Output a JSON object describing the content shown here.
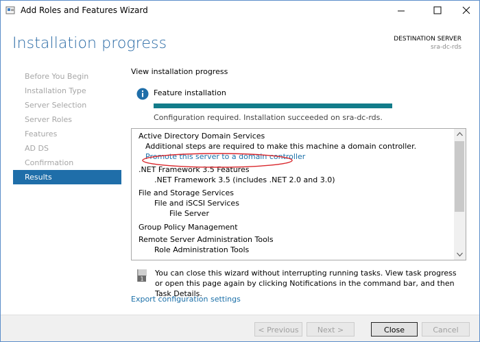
{
  "window": {
    "title": "Add Roles and Features Wizard"
  },
  "header": {
    "page_title": "Installation progress",
    "destination_label": "DESTINATION SERVER",
    "destination_name": "sra-dc-rds"
  },
  "nav": {
    "items": [
      {
        "label": "Before You Begin",
        "active": false
      },
      {
        "label": "Installation Type",
        "active": false
      },
      {
        "label": "Server Selection",
        "active": false
      },
      {
        "label": "Server Roles",
        "active": false
      },
      {
        "label": "Features",
        "active": false
      },
      {
        "label": "AD DS",
        "active": false
      },
      {
        "label": "Confirmation",
        "active": false
      },
      {
        "label": "Results",
        "active": true
      }
    ]
  },
  "main": {
    "heading": "View installation progress",
    "feature_label": "Feature installation",
    "progress_fraction": 1.0,
    "status_message": "Configuration required. Installation succeeded on sra-dc-rds.",
    "results": [
      {
        "text": "Active Directory Domain Services",
        "indent": 0,
        "kind": "heading"
      },
      {
        "text": "Additional steps are required to make this machine a domain controller.",
        "indent": 1,
        "kind": "text"
      },
      {
        "text": "Promote this server to a domain controller",
        "indent": 1,
        "kind": "link"
      },
      {
        "text": ".NET Framework 3.5 Features",
        "indent": 0,
        "kind": "heading"
      },
      {
        "text": ".NET Framework 3.5 (includes .NET 2.0 and 3.0)",
        "indent": 2,
        "kind": "text"
      },
      {
        "text": "File and Storage Services",
        "indent": 0,
        "kind": "heading"
      },
      {
        "text": "File and iSCSI Services",
        "indent": 2,
        "kind": "text"
      },
      {
        "text": "File Server",
        "indent": 3,
        "kind": "text"
      },
      {
        "text": "Group Policy Management",
        "indent": 0,
        "kind": "heading"
      },
      {
        "text": "Remote Server Administration Tools",
        "indent": 0,
        "kind": "heading"
      },
      {
        "text": "Role Administration Tools",
        "indent": 2,
        "kind": "text"
      }
    ],
    "note": "You can close this wizard without interrupting running tasks. View task progress or open this page again by clicking Notifications in the command bar, and then Task Details.",
    "note_badge": "1",
    "export_link": "Export configuration settings"
  },
  "footer": {
    "previous_label": "< Previous",
    "next_label": "Next >",
    "close_label": "Close",
    "cancel_label": "Cancel"
  },
  "colors": {
    "accent": "#2b6ba6",
    "nav_active": "#1f6ea9",
    "progress": "#127c8a",
    "link": "#1a6fa8",
    "annotation": "#d9262b"
  },
  "icons": {
    "app": "server-manager-icon",
    "info": "info-icon",
    "note": "notification-flag-icon"
  }
}
